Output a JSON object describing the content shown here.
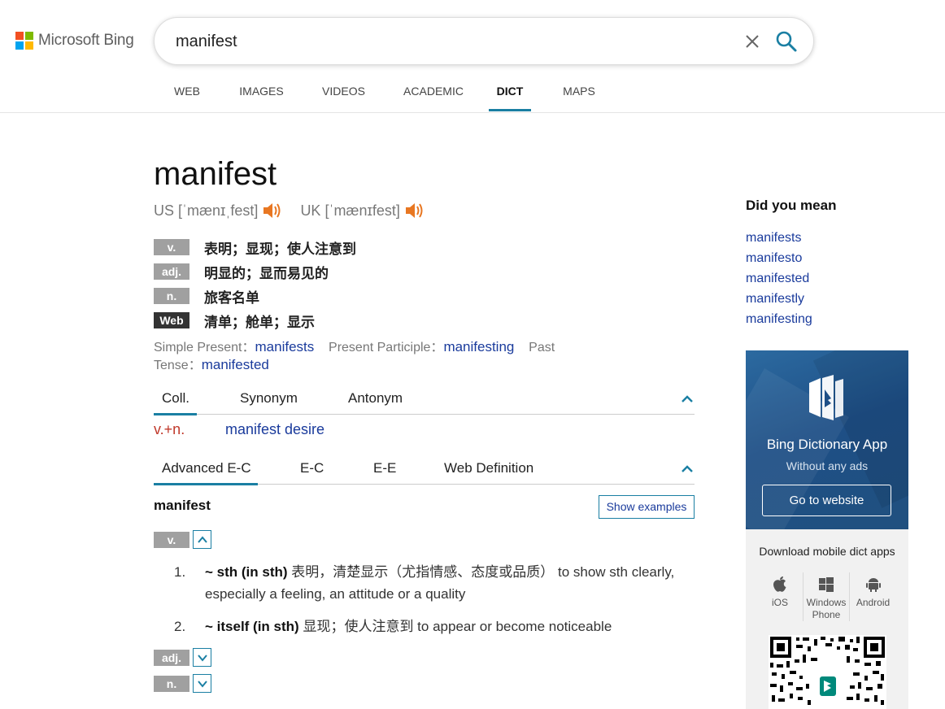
{
  "header": {
    "logo_text": "Microsoft Bing",
    "search_value": "manifest",
    "scopes": [
      "WEB",
      "IMAGES",
      "VIDEOS",
      "ACADEMIC",
      "DICT",
      "MAPS"
    ],
    "active_scope": "DICT"
  },
  "entry": {
    "word": "manifest",
    "us_label": "US [ˈmænɪˌfest]",
    "uk_label": "UK [ˈmænɪfest]",
    "definitions": [
      {
        "pos": "v.",
        "text": "表明；显现；使人注意到"
      },
      {
        "pos": "adj.",
        "text": "明显的；显而易见的"
      },
      {
        "pos": "n.",
        "text": "旅客名单"
      },
      {
        "pos": "Web",
        "text": "清单；舱单；显示"
      }
    ],
    "inflections": {
      "simple_present_label": "Simple Present：",
      "simple_present": "manifests",
      "present_participle_label": "Present Participle：",
      "present_participle": "manifesting",
      "past_tense_label_1": "Past",
      "past_tense_label_2": "Tense：",
      "past_tense": "manifested"
    }
  },
  "collocation_tabs": [
    "Coll.",
    "Synonym",
    "Antonym"
  ],
  "collocation": {
    "label": "v.+n.",
    "value": "manifest desire"
  },
  "advanced_tabs": [
    "Advanced E-C",
    "E-C",
    "E-E",
    "Web Definition"
  ],
  "advanced": {
    "headword": "manifest",
    "show_examples": "Show examples",
    "pos_v": "v.",
    "pos_adj": "adj.",
    "pos_n": "n.",
    "senses": [
      {
        "num": "1.",
        "pattern": "~ sth (in sth)",
        "zh": " 表明，清楚显示（尤指情感、态度或品质）",
        "en": " to show sth clearly, especially a feeling, an attitude or a quality"
      },
      {
        "num": "2.",
        "pattern": "~ itself (in sth)",
        "zh": " 显现；使人注意到",
        "en": " to appear or become noticeable"
      }
    ]
  },
  "sidebar": {
    "did_you_mean_title": "Did you mean",
    "suggestions": [
      "manifests",
      "manifesto",
      "manifested",
      "manifestly",
      "manifesting"
    ],
    "app_title": "Bing Dictionary App",
    "app_subtitle": "Without any ads",
    "goto_label": "Go to website",
    "download_title": "Download mobile dict apps",
    "platforms": [
      {
        "icon": "apple-icon",
        "label_1": "iOS",
        "label_2": ""
      },
      {
        "icon": "windows-icon",
        "label_1": "Windows",
        "label_2": "Phone"
      },
      {
        "icon": "android-icon",
        "label_1": "Android",
        "label_2": ""
      }
    ]
  },
  "colors": {
    "accent": "#1a7fa3",
    "link": "#1a3b9c",
    "collocation_label": "#c0392b",
    "speaker": "#e87722"
  }
}
